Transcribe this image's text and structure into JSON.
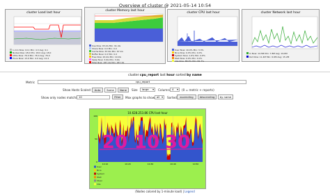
{
  "page_title": "Overview of cluster @ 2021-05-14 10:54",
  "overview_panels": [
    {
      "title": "cluster Load last hour",
      "legend": [
        "1-min",
        "Nodes",
        "CPUs",
        "Procs"
      ]
    },
    {
      "title": "cluster Memory last hour",
      "legend": [
        "Use",
        "Share",
        "Cache",
        "Buffer",
        "Free",
        "Swap",
        "Total"
      ]
    },
    {
      "title": "cluster CPU last hour",
      "legend": [
        "User",
        "Nice",
        "System",
        "Wait",
        "Steal",
        "Idle"
      ]
    },
    {
      "title": "cluster Network last hour",
      "legend": [
        "In",
        "Out"
      ]
    }
  ],
  "report_header": {
    "prefix": "cluster",
    "metric": "cpu_report",
    "middle": "last",
    "range": "hour",
    "sorted": "sorted",
    "sort": "by name"
  },
  "controls": {
    "metric_label": "Metric",
    "metric_value": "cpu_report",
    "show_hosts_scaled_label": "Show Hosts Scaled:",
    "auto_label": "Auto",
    "same_label": "Same",
    "none_label": "None",
    "size_label": "Size",
    "size_value": "large",
    "columns_label": "Columns",
    "columns_value": "4",
    "columns_suffix": "(0 = metric + reports)",
    "show_only_label": "Show only nodes matching",
    "filter_value": "10",
    "filter_button": "Filter",
    "max_graphs_label": "Max graphs to show",
    "max_graphs_value": "all",
    "sorted_label": "Sorted",
    "ascending_label": "ascending",
    "descending_label": "descending",
    "by_name_label": "by name"
  },
  "host_graph": {
    "title": "10.628.253.86 CPU last hour",
    "x_ticks": [
      "10:10",
      "10:20",
      "10:30",
      "10:40",
      "10:50"
    ],
    "y_ticks": [
      "100",
      "50",
      "0"
    ],
    "legend": [
      "User",
      "Nice",
      "System",
      "Wait",
      "Steal",
      "Idle"
    ],
    "colors": {
      "user": "#3355cc",
      "system": "#cc0000",
      "idle": "#f6ff3a",
      "background": "#9cef4e"
    },
    "annotations": [
      "20",
      "10",
      "30"
    ],
    "annotation_color": "#e01aa0"
  },
  "footer": {
    "text": "(Nodes colored by 1-minute load)",
    "separator": "|",
    "legend_link": "Legend"
  }
}
